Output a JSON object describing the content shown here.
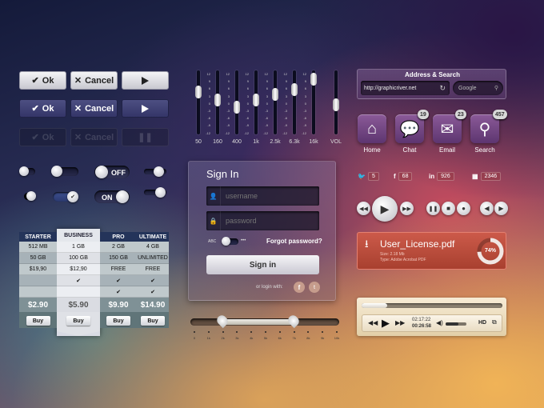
{
  "buttons": {
    "ok": "Ok",
    "cancel": "Cancel"
  },
  "toggles": {
    "off": "OFF",
    "on": "ON"
  },
  "pricing": {
    "headers": [
      "STARTER",
      "BUSINESS",
      "PRO",
      "ULTIMATE"
    ],
    "rows": [
      [
        "512 MB",
        "1 GB",
        "2 GB",
        "4 GB"
      ],
      [
        "50 GB",
        "100 GB",
        "150 GB",
        "UNLIMITED"
      ],
      [
        "$19,90",
        "$12,90",
        "FREE",
        "FREE"
      ],
      [
        "",
        "✔",
        "✔",
        "✔"
      ],
      [
        "",
        "",
        "✔",
        "✔"
      ]
    ],
    "prices": [
      "$2.90",
      "$5.90",
      "$9.90",
      "$14.90"
    ],
    "buy_label": "Buy"
  },
  "equalizer": {
    "scale": [
      "12",
      "9",
      "6",
      "3",
      "0",
      "-3",
      "-6",
      "-9",
      "-12"
    ],
    "bands": [
      {
        "label": "50",
        "level": 0.3
      },
      {
        "label": "160",
        "level": 0.46
      },
      {
        "label": "400",
        "level": 0.6
      },
      {
        "label": "1k",
        "level": 0.45
      },
      {
        "label": "2.5k",
        "level": 0.35
      },
      {
        "label": "6.3k",
        "level": 0.25
      },
      {
        "label": "16k",
        "level": 0.05
      }
    ],
    "vol": {
      "label": "VOL",
      "level": 0.55
    }
  },
  "signin": {
    "title": "Sign In",
    "username_placeholder": "username",
    "password_placeholder": "password",
    "abc": "ABC",
    "dots": "•••",
    "forgot": "Forgot password?",
    "submit": "Sign in",
    "or_login": "or login with:"
  },
  "range_slider": {
    "labels": [
      "0",
      "1k",
      "2k",
      "3k",
      "4k",
      "5k",
      "6k",
      "7k",
      "8k",
      "9k",
      "10k"
    ],
    "low": 0.2,
    "high": 0.7
  },
  "address": {
    "title": "Address & Search",
    "url": "http://graphicriver.net",
    "search_placeholder": "Google"
  },
  "apps": [
    {
      "label": "Home",
      "badge": "",
      "icon": "home-icon"
    },
    {
      "label": "Chat",
      "badge": "19",
      "icon": "chat-icon"
    },
    {
      "label": "Email",
      "badge": "23",
      "icon": "email-icon"
    },
    {
      "label": "Search",
      "badge": "457",
      "icon": "search-icon"
    }
  ],
  "social": [
    {
      "icon": "twitter-icon",
      "count": "5"
    },
    {
      "icon": "facebook-icon",
      "count": "68"
    },
    {
      "icon": "linkedin-icon",
      "count": "926"
    },
    {
      "icon": "forrst-icon",
      "count": "2346"
    }
  ],
  "download": {
    "filename": "User_License.pdf",
    "size": "Size: 2.18 Mb",
    "type": "Type: Adobe Acrobat PDF",
    "progress_label": "74%",
    "progress": 0.74
  },
  "player": {
    "time_elapsed": "02:17:22",
    "time_total": "00:26:58",
    "hd": "HD",
    "progress": 0.18,
    "volume": 0.6
  },
  "colors": {
    "accent": "#c24a3c",
    "purple": "#6e4280"
  }
}
